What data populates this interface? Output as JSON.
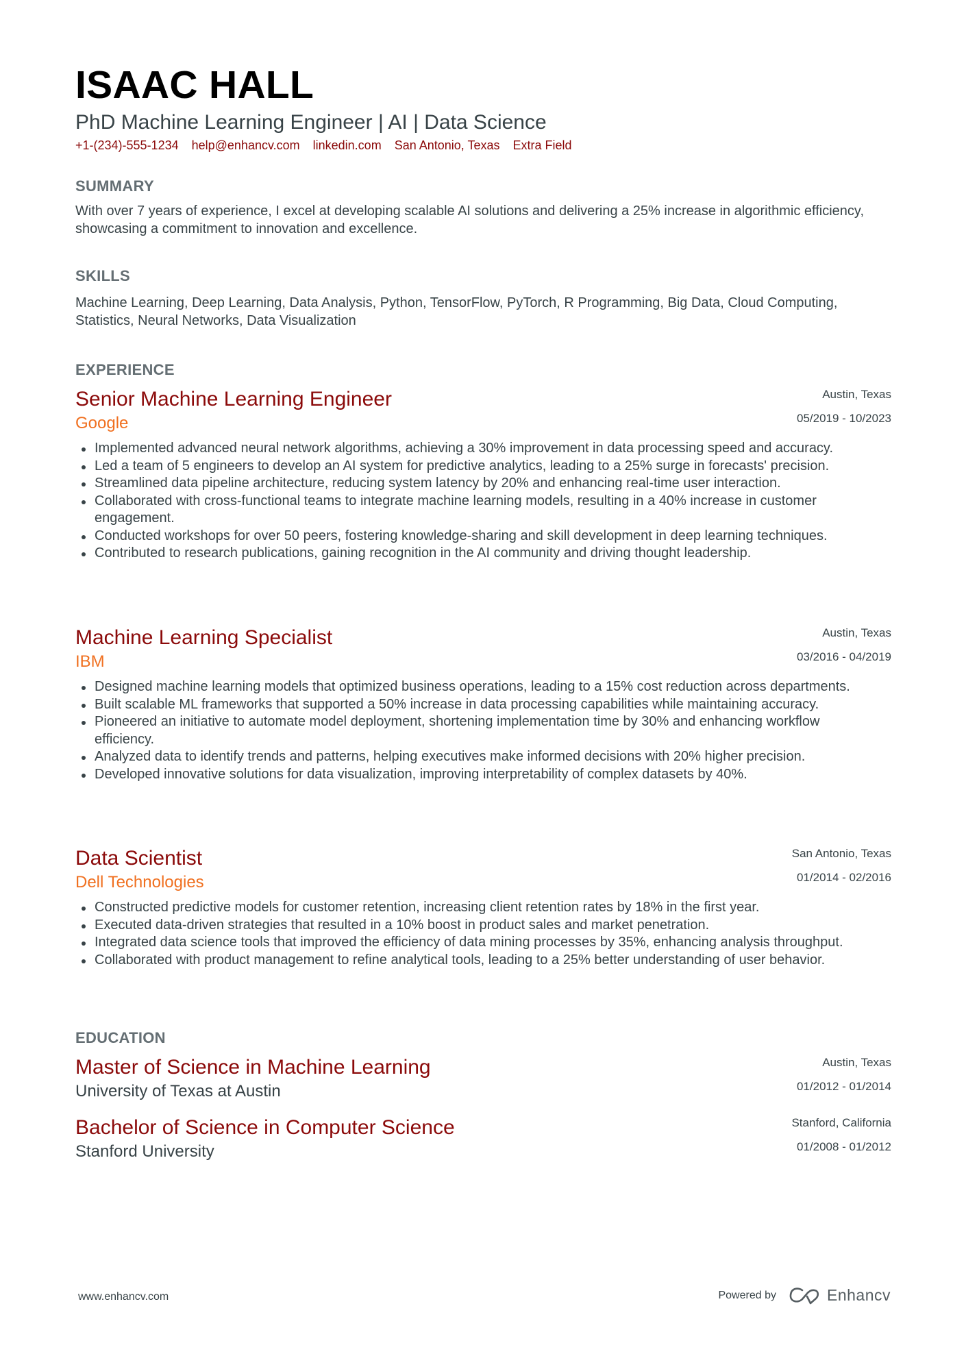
{
  "header": {
    "name": "ISAAC HALL",
    "subtitle": "PhD Machine Learning Engineer | AI | Data Science",
    "contacts": {
      "phone": "+1-(234)-555-1234",
      "email": "help@enhancv.com",
      "linkedin": "linkedin.com",
      "location": "San Antonio, Texas",
      "extra": "Extra Field"
    }
  },
  "summary": {
    "heading": "SUMMARY",
    "text": "With over 7 years of experience, I excel at developing scalable AI solutions and delivering a 25% increase in algorithmic efficiency, showcasing a commitment to innovation and excellence."
  },
  "skills": {
    "heading": "SKILLS",
    "text": "Machine Learning, Deep Learning, Data Analysis, Python, TensorFlow, PyTorch, R Programming, Big Data, Cloud Computing, Statistics, Neural Networks, Data Visualization"
  },
  "experience": {
    "heading": "EXPERIENCE",
    "items": [
      {
        "title": "Senior Machine Learning Engineer",
        "company": "Google",
        "location": "Austin, Texas",
        "dates": "05/2019 - 10/2023",
        "bullets": [
          "Implemented advanced neural network algorithms, achieving a 30% improvement in data processing speed and accuracy.",
          "Led a team of 5 engineers to develop an AI system for predictive analytics, leading to a 25% surge in forecasts' precision.",
          "Streamlined data pipeline architecture, reducing system latency by 20% and enhancing real-time user interaction.",
          "Collaborated with cross-functional teams to integrate machine learning models, resulting in a 40% increase in customer engagement.",
          "Conducted workshops for over 50 peers, fostering knowledge-sharing and skill development in deep learning techniques.",
          "Contributed to research publications, gaining recognition in the AI community and driving thought leadership."
        ]
      },
      {
        "title": "Machine Learning Specialist",
        "company": "IBM",
        "location": "Austin, Texas",
        "dates": "03/2016 - 04/2019",
        "bullets": [
          "Designed machine learning models that optimized business operations, leading to a 15% cost reduction across departments.",
          "Built scalable ML frameworks that supported a 50% increase in data processing capabilities while maintaining accuracy.",
          "Pioneered an initiative to automate model deployment, shortening implementation time by 30% and enhancing workflow efficiency.",
          "Analyzed data to identify trends and patterns, helping executives make informed decisions with 20% higher precision.",
          "Developed innovative solutions for data visualization, improving interpretability of complex datasets by 40%."
        ]
      },
      {
        "title": "Data Scientist",
        "company": "Dell Technologies",
        "location": "San Antonio, Texas",
        "dates": "01/2014 - 02/2016",
        "bullets": [
          "Constructed predictive models for customer retention, increasing client retention rates by 18% in the first year.",
          "Executed data-driven strategies that resulted in a 10% boost in product sales and market penetration.",
          "Integrated data science tools that improved the efficiency of data mining processes by 35%, enhancing analysis throughput.",
          "Collaborated with product management to refine analytical tools, leading to a 25% better understanding of user behavior."
        ]
      }
    ]
  },
  "education": {
    "heading": "EDUCATION",
    "items": [
      {
        "degree": "Master of Science in Machine Learning",
        "school": "University of Texas at Austin",
        "location": "Austin, Texas",
        "dates": "01/2012 - 01/2014"
      },
      {
        "degree": "Bachelor of Science in Computer Science",
        "school": "Stanford University",
        "location": "Stanford, California",
        "dates": "01/2008 - 01/2012"
      }
    ]
  },
  "footer": {
    "website": "www.enhancv.com",
    "powered_by": "Powered by",
    "brand_icon": "enhancv-logo-icon",
    "brand": "Enhancv"
  },
  "colors": {
    "title": "#8b0a0a",
    "company": "#f07020",
    "contacts": "#8b0a0a",
    "section_heading": "#646e73",
    "body_text": "#384347"
  }
}
